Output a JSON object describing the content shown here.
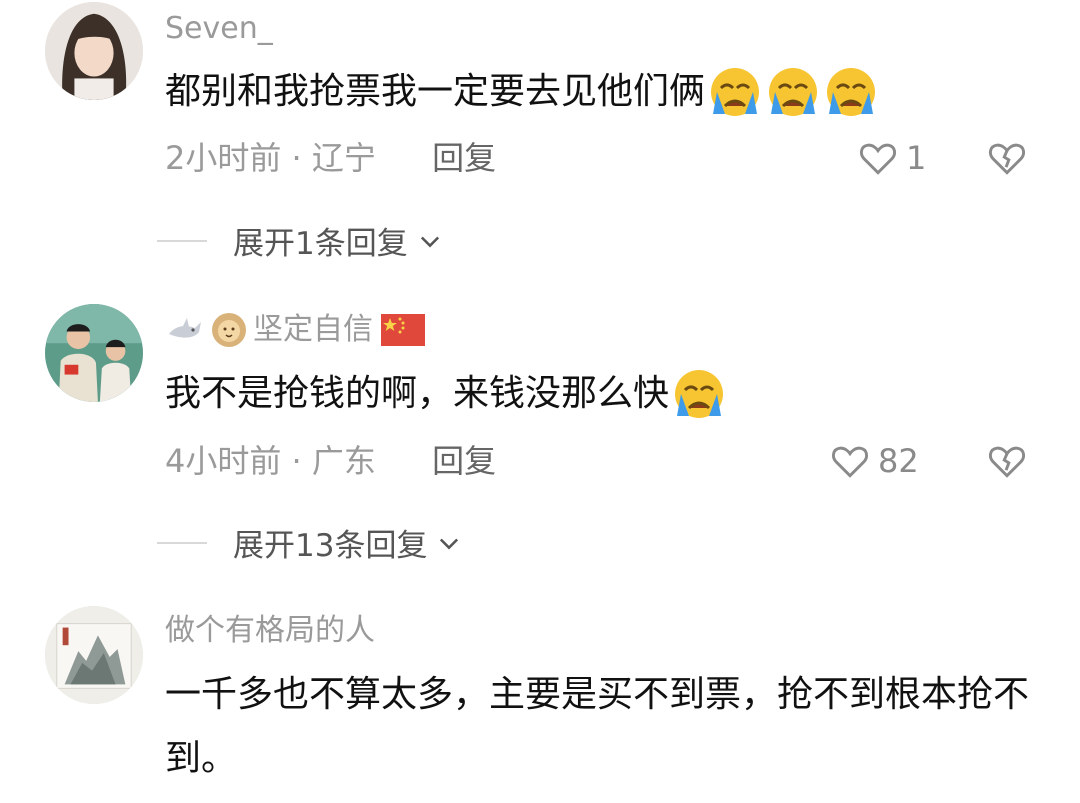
{
  "comments": [
    {
      "username": "Seven_",
      "text": "都别和我抢票我一定要去见他们俩",
      "emojis": [
        "crying-face-emoji",
        "crying-face-emoji",
        "crying-face-emoji"
      ],
      "time": "2小时前",
      "location": "辽宁",
      "reply_label": "回复",
      "likes": "1",
      "expand_label": "展开1条回复"
    },
    {
      "username": "坚定自信",
      "text": "我不是抢钱的啊，来钱没那么快",
      "emojis": [
        "crying-face-emoji"
      ],
      "time": "4小时前",
      "location": "广东",
      "reply_label": "回复",
      "likes": "82",
      "expand_label": "展开13条回复"
    },
    {
      "username": "做个有格局的人",
      "text": "一千多也不算太多，主要是买不到票，抢不到根本抢不到。"
    }
  ],
  "separator": "·",
  "colors": {
    "meta": "#9a9a9a",
    "text": "#111111",
    "emoji_face": "#f7c531",
    "emoji_tear": "#3d9be9"
  }
}
